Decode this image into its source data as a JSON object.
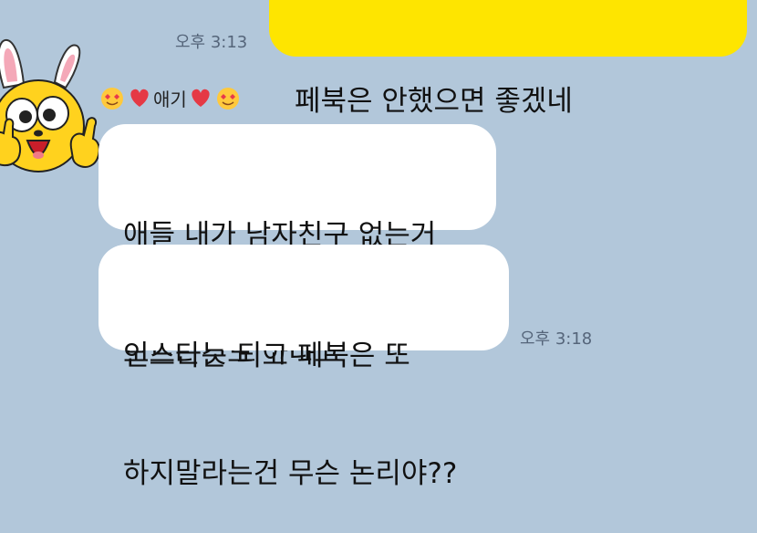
{
  "chat": {
    "mine": {
      "text": "페북은 안했으면 좋겠네",
      "time": "오후 3:13"
    },
    "theirs": {
      "sender": "애기",
      "bubbles": [
        {
          "lines": [
            "애들 내가 남자친구 없는거",
            "모르는것도 아니고"
          ]
        },
        {
          "lines": [
            "인스타는 되고 페북은 또",
            "하지말라는건 무슨 논리야??"
          ]
        }
      ],
      "time": "오후 3:18"
    }
  },
  "icons": {
    "sender_decoration": [
      "heart-eyes-emoji",
      "red-heart",
      "red-heart",
      "heart-eyes-emoji"
    ],
    "avatar": "yellow-bunny-character"
  },
  "colors": {
    "background": "#b2c7da",
    "my_bubble": "#fee500",
    "their_bubble": "#ffffff",
    "time_text": "#55657a"
  }
}
